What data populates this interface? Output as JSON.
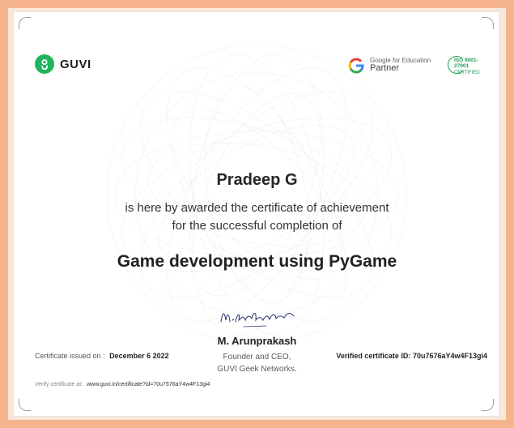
{
  "brand": {
    "name": "GUVI",
    "logo_icon": "guvi-logo-icon",
    "color": "#22b35c"
  },
  "partner": {
    "line1": "Google for Education",
    "line2": "Partner",
    "icon": "google-g-icon"
  },
  "iso": {
    "line1": "ISO 9001-27001",
    "line2": "CERTIFIED",
    "color": "#1f9d55"
  },
  "certificate": {
    "recipient": "Pradeep G",
    "award_line1": "is here by awarded the certificate of achievement",
    "award_line2": "for the successful completion of",
    "course": "Game development using PyGame"
  },
  "signatory": {
    "signature_text": "M. Arunprakash",
    "name": "M. Arunprakash",
    "role_line1": "Founder and CEO,",
    "role_line2": "GUVI Geek Networks."
  },
  "issued": {
    "label": "Certificate issued on :",
    "date": "December 6 2022"
  },
  "verified_id": {
    "label": "Verified certificate ID:",
    "value": "70u7676aY4w4F13gi4"
  },
  "verify": {
    "label": "Verify certificate at:",
    "url": "www.guvi.in/certificate?id=70u7676aY4w4F13gi4"
  }
}
